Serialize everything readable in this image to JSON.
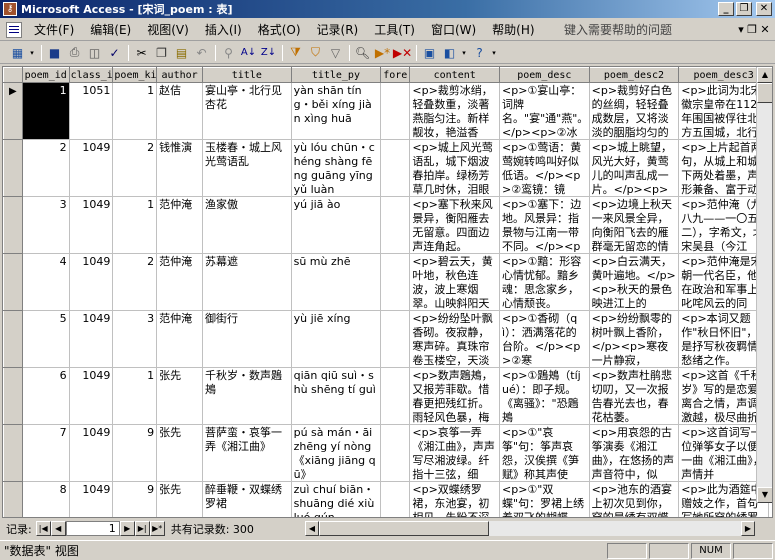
{
  "window": {
    "title": "Microsoft Access - [宋词_poem : 表]"
  },
  "menu": {
    "items": [
      "文件(F)",
      "编辑(E)",
      "视图(V)",
      "插入(I)",
      "格式(O)",
      "记录(R)",
      "工具(T)",
      "窗口(W)",
      "帮助(H)"
    ],
    "help_placeholder": "键入需要帮助的问题"
  },
  "toolbar": {
    "icons": [
      "view-icon",
      "save-icon",
      "print-icon",
      "print-preview-icon",
      "spell-check-icon",
      "cut-icon",
      "copy-icon",
      "paste-icon",
      "undo-icon",
      "hyperlink-icon",
      "sort-ascending-icon",
      "sort-descending-icon",
      "filter-by-selection-icon",
      "filter-by-form-icon",
      "apply-filter-icon",
      "find-icon",
      "new-record-icon",
      "delete-record-icon",
      "database-window-icon",
      "new-object-icon",
      "help-icon"
    ]
  },
  "table": {
    "columns": [
      "poem_id",
      "class_i",
      "poem_ki",
      "author",
      "title",
      "title_py",
      "fore",
      "content",
      "poem_desc",
      "poem_desc2",
      "poem_desc3"
    ],
    "rows": [
      {
        "poem_id": "1",
        "class_i": "1051",
        "poem_ki": "1",
        "author": "赵佶",
        "title": "宴山亭・北行见杏花",
        "title_py": "yàn shān tíng・běi xíng jiàn xìng huā",
        "fore": "",
        "content": "<p>裁剪冰绡，轻叠数重，淡著燕脂匀注。新样靓妆，艳溢香",
        "poem_desc": "<p>①宴山亭：词牌名。\"宴\"通\"燕\"。</p><p>②冰",
        "poem_desc2": "<p>裁剪好白色的丝绸，轻轻叠成数层，又将淡淡的胭脂均匀的",
        "poem_desc3": "<p>此词为北宋徽宗皇帝在1127年围国被俘往北方五国城，北行"
      },
      {
        "poem_id": "2",
        "class_i": "1049",
        "poem_ki": "2",
        "author": "钱惟演",
        "title": "玉楼春・城上风光莺语乱",
        "title_py": "yù lóu chūn・chéng shàng fēng guāng yīng yǔ luàn",
        "fore": "",
        "content": "<p>城上风光莺语乱，城下烟波春拍岸。绿杨芳草几时休，泪眼",
        "poem_desc": "<p>①莺语：黄莺婉转鸣叫好似低语。</p><p>②鸾镜：镜子。",
        "poem_desc2": "<p>城上眺望，风光大好，黄莺儿的叫声乱成一片。</p><p>城",
        "poem_desc3": "<p>上片起首两句，从城上和城下两处着墨，声形兼备、富于动"
      },
      {
        "poem_id": "3",
        "class_i": "1049",
        "poem_ki": "1",
        "author": "范仲淹",
        "title": "渔家傲",
        "title_py": "yú jiā ào",
        "fore": "",
        "content": "<p>塞下秋来风景异，衡阳雁去无留意。四面边声连角起。",
        "poem_desc": "<p>①塞下：边地。风景异：指景物与江南一带不同。</p><p>",
        "poem_desc2": "<p>边境上秋天一来风景全异，向衡阳飞去的雁群毫无留恋的情",
        "poem_desc3": "<p>范仲淹（九八九——一〇五二），字希文，北宋吴县（今江"
      },
      {
        "poem_id": "4",
        "class_i": "1049",
        "poem_ki": "2",
        "author": "范仲淹",
        "title": "苏幕遮",
        "title_py": "sū mù zhē",
        "fore": "",
        "content": "<p>碧云天，黄叶地，秋色连波，波上寒烟翠。山映斜阳天",
        "poem_desc": "<p>①黯：形容心情忧郁。黯乡魂：思念家乡，心情颓丧。",
        "poem_desc2": "<p>白云满天，黄叶遍地。</p><p>秋天的景色映进江上的",
        "poem_desc3": "<p>范仲淹是宋朝一代名臣，他在政治和军事上叱咤风云的同"
      },
      {
        "poem_id": "5",
        "class_i": "1049",
        "poem_ki": "3",
        "author": "范仲淹",
        "title": "御街行",
        "title_py": "yù jiē xíng",
        "fore": "",
        "content": "<p>纷纷坠叶飘香砌。夜寂静，寒声碎。真珠帘卷玉楼空，天淡",
        "poem_desc": "<p>①香砌（qì）：洒满落花的台阶。</p><p>②寒",
        "poem_desc2": "<p>纷纷飘零的树叶飘上香阶，</p><p>寒夜一片静寂，",
        "poem_desc3": "<p>本词又题作\"秋日怀旧\"，是抒写秋夜羁情愁绪之作。"
      },
      {
        "poem_id": "6",
        "class_i": "1049",
        "poem_ki": "1",
        "author": "张先",
        "title": "千秋岁・数声鶗鴂",
        "title_py": "qiān qiū suì・shù shēng tí guì",
        "fore": "",
        "content": "<p>数声鶗鴂，又报芳菲歇。惜春更把残红折。雨轻风色暴，梅",
        "poem_desc": "<p>①鶗鴂（tíjué）：即子规。《离骚》：\"恐鶗鴂",
        "poem_desc2": "<p>数声杜鹃悲切叨，又一次报告春光去也，春花枯萎。",
        "poem_desc3": "<p>这首《千秋岁》写的是恋爱离合之情，声调激越，极尽曲折"
      },
      {
        "poem_id": "7",
        "class_i": "1049",
        "poem_ki": "9",
        "author": "张先",
        "title": "菩萨蛮・哀筝一弄《湘江曲》",
        "title_py": "pú sà mán・āi zhēng yí nòng《xiāng jiāng qū》",
        "fore": "",
        "content": "<p>哀筝一弄《湘江曲》，声声写尽湘波绿。纤指十三弦，细",
        "poem_desc": "<p>①\"哀筝\"句：筝声哀怨，汉俟撰《笋赋》称其声使人\"感",
        "poem_desc2": "<p>用哀怨的古筝演奏《湘江曲》，在悠扬的声声音符中，似",
        "poem_desc3": "<p>这首词写一位弹筝女子以便一曲《湘江曲》，声情并"
      },
      {
        "poem_id": "8",
        "class_i": "1049",
        "poem_ki": "9",
        "author": "张先",
        "title": "醉垂鞭・双蝶绣罗裙",
        "title_py": "zuì chuí biān・shuāng dié xiù luó qún",
        "fore": "",
        "content": "<p>双蝶绣罗裙，东池宴，初相见。朱粉不深匀，闲花淡淡",
        "poem_desc": "<p>①\"双蝶\"句：罗裙上绣着双飞的蝴蝶。</p><p>②\"朱",
        "poem_desc2": "<p>池东的酒宴上初次见到你，穿的是绣有双蝶的罗裙，",
        "poem_desc3": "<p>此为酒筵中赠妓之作，首句写她所穿的绣罗裙，\"双蝶\"二"
      }
    ]
  },
  "navigation": {
    "label": "记录:",
    "current": "1",
    "count_text": "共有记录数: 300"
  },
  "status": {
    "view_text": "\"数据表\" 视图",
    "num_indicator": "NUM"
  }
}
